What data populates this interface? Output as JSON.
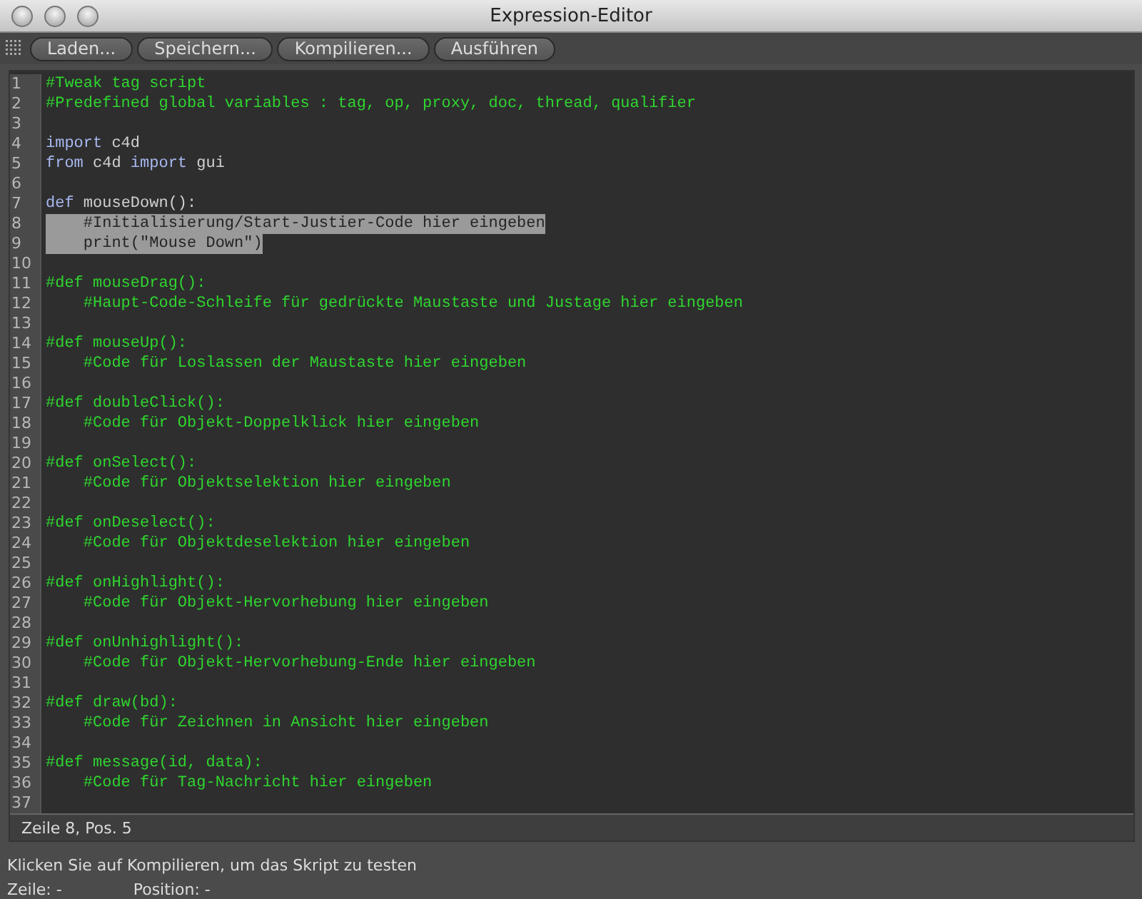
{
  "window": {
    "title": "Expression-Editor"
  },
  "toolbar": {
    "buttons": [
      "Laden...",
      "Speichern...",
      "Kompilieren...",
      "Ausführen"
    ]
  },
  "editor": {
    "lines": [
      {
        "number": "1",
        "selected": false,
        "tokens": [
          {
            "kind": "comment",
            "text": "#Tweak tag script"
          }
        ]
      },
      {
        "number": "2",
        "selected": false,
        "tokens": [
          {
            "kind": "comment",
            "text": "#Predefined global variables : tag, op, proxy, doc, thread, qualifier"
          }
        ]
      },
      {
        "number": "3",
        "selected": false
      },
      {
        "number": "4",
        "selected": false,
        "tokens": [
          {
            "kind": "keyword",
            "text": "import"
          },
          {
            "kind": "plain",
            "text": " c4d"
          }
        ]
      },
      {
        "number": "5",
        "selected": false,
        "tokens": [
          {
            "kind": "keyword",
            "text": "from"
          },
          {
            "kind": "plain",
            "text": " c4d "
          },
          {
            "kind": "keyword",
            "text": "import"
          },
          {
            "kind": "plain",
            "text": " gui"
          }
        ]
      },
      {
        "number": "6",
        "selected": false
      },
      {
        "number": "7",
        "selected": false,
        "tokens": [
          {
            "kind": "keyword",
            "text": "def"
          },
          {
            "kind": "plain",
            "text": " mouseDown():"
          }
        ]
      },
      {
        "number": "8",
        "selected": true,
        "tokens": [
          {
            "kind": "plain",
            "text": "    #Initialisierung/Start-Justier-Code hier eingeben"
          }
        ]
      },
      {
        "number": "9",
        "selected": true,
        "tokens": [
          {
            "kind": "plain",
            "text": "    print(\"Mouse Down\")"
          }
        ]
      },
      {
        "number": "10",
        "selected": false
      },
      {
        "number": "11",
        "selected": false,
        "tokens": [
          {
            "kind": "comment",
            "text": "#def mouseDrag():"
          }
        ]
      },
      {
        "number": "12",
        "selected": false,
        "tokens": [
          {
            "kind": "comment",
            "text": "    #Haupt-Code-Schleife für gedrückte Maustaste und Justage hier eingeben"
          }
        ]
      },
      {
        "number": "13",
        "selected": false
      },
      {
        "number": "14",
        "selected": false,
        "tokens": [
          {
            "kind": "comment",
            "text": "#def mouseUp():"
          }
        ]
      },
      {
        "number": "15",
        "selected": false,
        "tokens": [
          {
            "kind": "comment",
            "text": "    #Code für Loslassen der Maustaste hier eingeben"
          }
        ]
      },
      {
        "number": "16",
        "selected": false
      },
      {
        "number": "17",
        "selected": false,
        "tokens": [
          {
            "kind": "comment",
            "text": "#def doubleClick():"
          }
        ]
      },
      {
        "number": "18",
        "selected": false,
        "tokens": [
          {
            "kind": "comment",
            "text": "    #Code für Objekt-Doppelklick hier eingeben"
          }
        ]
      },
      {
        "number": "19",
        "selected": false
      },
      {
        "number": "20",
        "selected": false,
        "tokens": [
          {
            "kind": "comment",
            "text": "#def onSelect():"
          }
        ]
      },
      {
        "number": "21",
        "selected": false,
        "tokens": [
          {
            "kind": "comment",
            "text": "    #Code für Objektselektion hier eingeben"
          }
        ]
      },
      {
        "number": "22",
        "selected": false
      },
      {
        "number": "23",
        "selected": false,
        "tokens": [
          {
            "kind": "comment",
            "text": "#def onDeselect():"
          }
        ]
      },
      {
        "number": "24",
        "selected": false,
        "tokens": [
          {
            "kind": "comment",
            "text": "    #Code für Objektdeselektion hier eingeben"
          }
        ]
      },
      {
        "number": "25",
        "selected": false
      },
      {
        "number": "26",
        "selected": false,
        "tokens": [
          {
            "kind": "comment",
            "text": "#def onHighlight():"
          }
        ]
      },
      {
        "number": "27",
        "selected": false,
        "tokens": [
          {
            "kind": "comment",
            "text": "    #Code für Objekt-Hervorhebung hier eingeben"
          }
        ]
      },
      {
        "number": "28",
        "selected": false
      },
      {
        "number": "29",
        "selected": false,
        "tokens": [
          {
            "kind": "comment",
            "text": "#def onUnhighlight():"
          }
        ]
      },
      {
        "number": "30",
        "selected": false,
        "tokens": [
          {
            "kind": "comment",
            "text": "    #Code für Objekt-Hervorhebung-Ende hier eingeben"
          }
        ]
      },
      {
        "number": "31",
        "selected": false
      },
      {
        "number": "32",
        "selected": false,
        "tokens": [
          {
            "kind": "comment",
            "text": "#def draw(bd):"
          }
        ]
      },
      {
        "number": "33",
        "selected": false,
        "tokens": [
          {
            "kind": "comment",
            "text": "    #Code für Zeichnen in Ansicht hier eingeben"
          }
        ]
      },
      {
        "number": "34",
        "selected": false
      },
      {
        "number": "35",
        "selected": false,
        "tokens": [
          {
            "kind": "comment",
            "text": "#def message(id, data):"
          }
        ]
      },
      {
        "number": "36",
        "selected": false,
        "tokens": [
          {
            "kind": "comment",
            "text": "    #Code für Tag-Nachricht hier eingeben"
          }
        ]
      },
      {
        "number": "37",
        "selected": false
      }
    ],
    "cursor_status": "Zeile 8, Pos. 5"
  },
  "status_bar": {
    "message": "Klicken Sie auf Kompilieren, um das Skript zu testen",
    "line_label": "Zeile: -",
    "position_label": "Position: -"
  }
}
